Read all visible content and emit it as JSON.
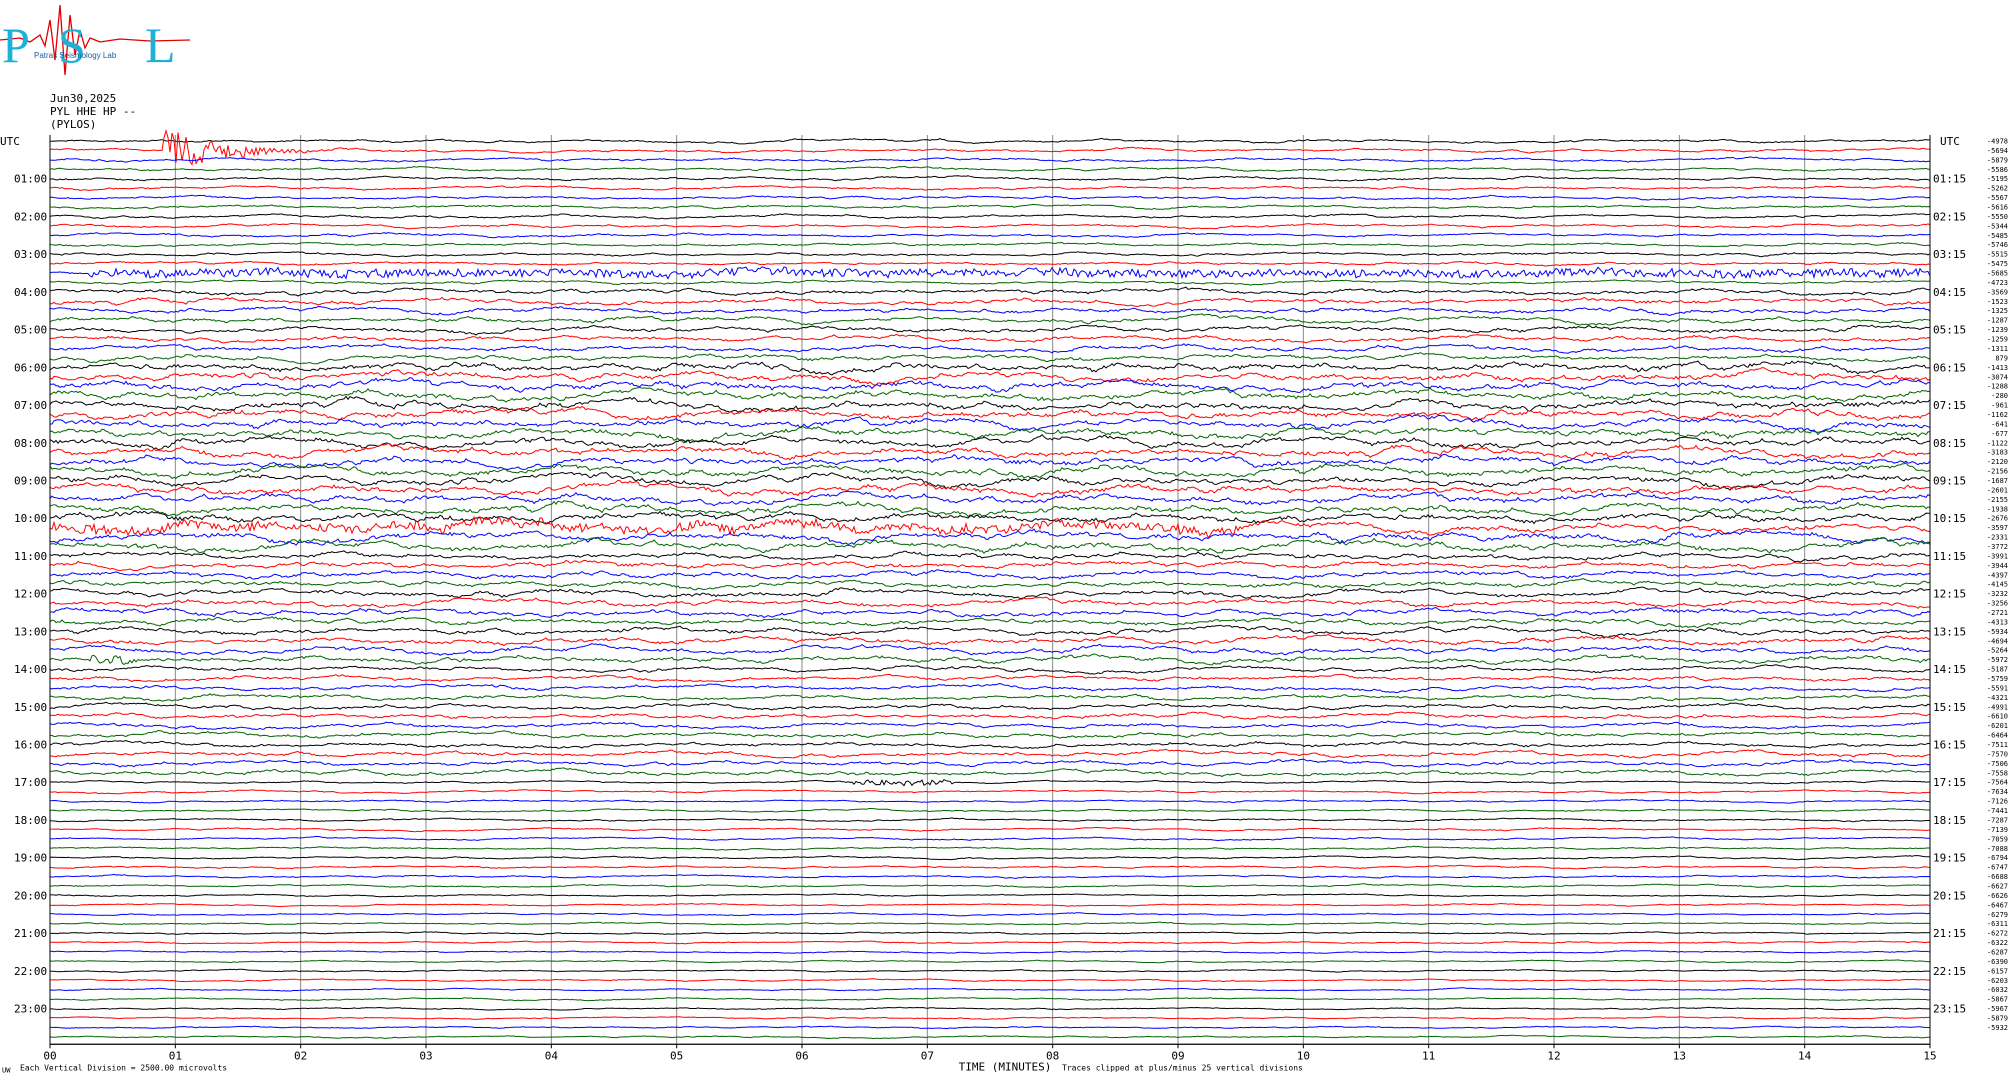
{
  "header": {
    "logo_text": "PSL",
    "logo_subtitle": "Patras Seismology Lab",
    "date": "Jun30,2025",
    "station": "PYL HHE HP --",
    "location": "(PYLOS)"
  },
  "footer": {
    "scale_note": "Each Vertical Division = 2500.00 microvolts",
    "clip_note": "Traces clipped at plus/minus 25 vertical divisions",
    "corner_mark": "UW"
  },
  "colors": {
    "black": "#000000",
    "red": "#ff0000",
    "blue": "#0000ff",
    "green": "#006400",
    "grid": "#888888"
  },
  "chart_data": {
    "type": "line",
    "title": "",
    "xlabel": "TIME (MINUTES)",
    "ylabel": "",
    "xlim": [
      0,
      15
    ],
    "x_ticks": [
      "00",
      "01",
      "02",
      "03",
      "04",
      "05",
      "06",
      "07",
      "08",
      "09",
      "10",
      "11",
      "12",
      "13",
      "14",
      "15"
    ],
    "left_axis_title": "UTC",
    "right_axis_title": "UTC",
    "left_hour_labels": [
      "01:00",
      "02:00",
      "03:00",
      "04:00",
      "05:00",
      "06:00",
      "07:00",
      "08:00",
      "09:00",
      "10:00",
      "11:00",
      "12:00",
      "13:00",
      "14:00",
      "15:00",
      "16:00",
      "17:00",
      "18:00",
      "19:00",
      "20:00",
      "21:00",
      "22:00",
      "23:00"
    ],
    "right_hour_labels": [
      "01:15",
      "02:15",
      "03:15",
      "04:15",
      "05:15",
      "06:15",
      "07:15",
      "08:15",
      "09:15",
      "10:15",
      "11:15",
      "12:15",
      "13:15",
      "14:15",
      "15:15",
      "16:15",
      "17:15",
      "18:15",
      "19:15",
      "20:15",
      "21:15",
      "22:15",
      "23:15"
    ],
    "trace_color_cycle": [
      "black",
      "red",
      "blue",
      "green"
    ],
    "trace_count": 96,
    "trace_offsets_microvolts": [
      "-4978",
      "-5694",
      "-5879",
      "-5586",
      "-5195",
      "-5262",
      "-5567",
      "-5616",
      "-5550",
      "-5344",
      "-5485",
      "-5746",
      "-5515",
      "-5475",
      "-5685",
      "-4723",
      "-3569",
      "-1523",
      "-1325",
      "-1287",
      "-1239",
      "-1259",
      "-1311",
      "879",
      "-1413",
      "-3074",
      "-1288",
      "-280",
      "-961",
      "-1162",
      "-641",
      "-677",
      "-1122",
      "-3183",
      "-2120",
      "-2156",
      "-1687",
      "-2601",
      "-2155",
      "-1938",
      "-2676",
      "-3597",
      "-2331",
      "-3772",
      "-3991",
      "-3944",
      "-4397",
      "-4145",
      "-3232",
      "-3256",
      "-2721",
      "-4313",
      "-5934",
      "-4694",
      "-5264",
      "-5972",
      "-5187",
      "-5759",
      "-5591",
      "-4321",
      "-4991",
      "-6610",
      "-6201",
      "-6464",
      "-7511",
      "-7570",
      "-7506",
      "-7558",
      "-7564",
      "-7634",
      "-7126",
      "-7441",
      "-7287",
      "-7139",
      "-7059",
      "-7088",
      "-6794",
      "-6747",
      "-6688",
      "-6627",
      "-6626",
      "-6467",
      "-6279",
      "-6311",
      "-6272",
      "-6322",
      "-6287",
      "-6390",
      "-6157",
      "-6203",
      "-6032",
      "-5867",
      "-5967",
      "-5879",
      "-5932",
      ""
    ],
    "events": [
      {
        "trace": 1,
        "start_min": 0.9,
        "end_min": 2.4,
        "amplitude": "large"
      },
      {
        "trace": 14,
        "start_min": 0.3,
        "end_min": 15.0,
        "amplitude": "medium"
      },
      {
        "trace": 41,
        "start_min": 0.0,
        "end_min": 9.5,
        "amplitude": "medium"
      },
      {
        "trace": 55,
        "start_min": 0.3,
        "end_min": 0.7,
        "amplitude": "medium"
      },
      {
        "trace": 68,
        "start_min": 6.4,
        "end_min": 7.2,
        "amplitude": "small"
      }
    ]
  }
}
